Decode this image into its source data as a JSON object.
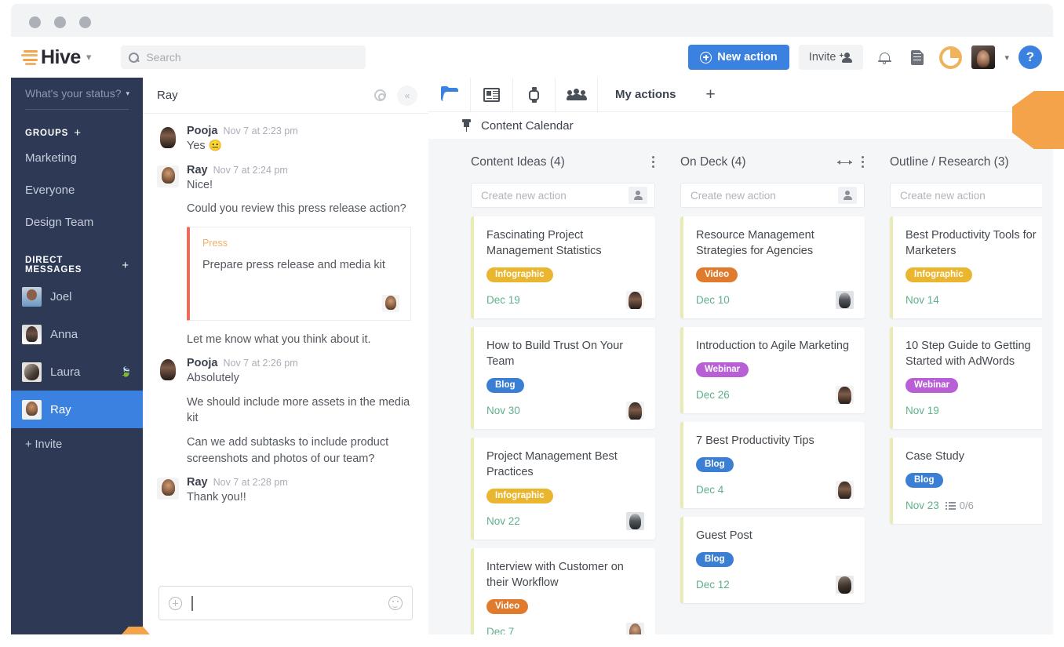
{
  "window": {
    "chrome_dots": [
      "close",
      "minimize",
      "maximize"
    ]
  },
  "header": {
    "logo_text": "Hive",
    "logo_caret": "▾",
    "search": {
      "placeholder": "Search",
      "value": "",
      "icon": "search-icon"
    },
    "new_action_label": "New action",
    "invite_label": "Invite",
    "icons": [
      "bell-icon",
      "document-icon",
      "time-tracking-icon"
    ],
    "avatar_caret": "▾",
    "help_label": "?",
    "accent_blue": "#3b82e0",
    "accent_orange": "#f5a34a"
  },
  "sidebar": {
    "status_placeholder": "What's your status?",
    "status_caret": "▾",
    "groups_label": "GROUPS",
    "groups_add": "+",
    "groups": [
      {
        "label": "Marketing"
      },
      {
        "label": "Everyone"
      },
      {
        "label": "Design Team"
      }
    ],
    "dm_label": "DIRECT MESSAGES",
    "dm_add": "+",
    "dms": [
      {
        "label": "Joel",
        "badge": "",
        "active": false
      },
      {
        "label": "Anna",
        "badge": "",
        "active": false
      },
      {
        "label": "Laura",
        "badge": "🍃",
        "active": false
      },
      {
        "label": "Ray",
        "badge": "",
        "active": true
      }
    ],
    "invite_label": "+ Invite"
  },
  "chat": {
    "title": "Ray",
    "gear_icon": "gear-icon",
    "collapse_icon": "«",
    "messages": [
      {
        "author": "Pooja",
        "time": "Nov 7 at 2:23 pm",
        "text": "Yes",
        "emoji": "😐",
        "avatar": "pooja"
      },
      {
        "author": "Ray",
        "time": "Nov 7 at 2:24 pm",
        "text": "Nice!",
        "avatar": "ray"
      }
    ],
    "ray_followup": "Could you review this press release action?",
    "action_card": {
      "project_tag": "Press",
      "title": "Prepare press release and media kit"
    },
    "ray_followup2": "Let me know what you think about it.",
    "pooja_message": {
      "author": "Pooja",
      "time": "Nov 7 at 2:26 pm",
      "text": "Absolutely",
      "line2": "We should include more assets in the media kit",
      "line3": "Can we add subtasks to include product screenshots and photos of our team?"
    },
    "ray_thanks": {
      "author": "Ray",
      "time": "Nov 7 at 2:28 pm",
      "text": "Thank you!!"
    },
    "input": {
      "placeholder": "",
      "value": "",
      "attach_icon": "plus-circle-icon",
      "emoji_icon": "smiley-icon"
    }
  },
  "project": {
    "toolbar_icons": [
      "folder-icon",
      "news-icon",
      "watch-icon",
      "people-icon"
    ],
    "tabs": [
      {
        "label": "My actions",
        "active": true
      }
    ],
    "add_tab": "+",
    "pin_icon": "pin-icon",
    "name": "Content Calendar"
  },
  "board": {
    "create_placeholder": "Create new action",
    "columns": [
      {
        "title": "Content Ideas (4)",
        "has_resize": false,
        "cards": [
          {
            "title": "Fascinating Project Management Statistics",
            "tag": "Infographic",
            "tag_type": "infographic",
            "date": "Dec 19",
            "subtasks": "",
            "avatar": "av-a"
          },
          {
            "title": "How to Build Trust On Your Team",
            "tag": "Blog",
            "tag_type": "blog",
            "date": "Nov 30",
            "subtasks": "",
            "avatar": "av-a"
          },
          {
            "title": "Project Management Best Practices",
            "tag": "Infographic",
            "tag_type": "infographic",
            "date": "Nov 22",
            "subtasks": "",
            "avatar": "av-b"
          },
          {
            "title": "Interview with Customer on their Workflow",
            "tag": "Video",
            "tag_type": "video",
            "date": "Dec 7",
            "subtasks": "",
            "avatar": "av-c"
          }
        ]
      },
      {
        "title": "On Deck (4)",
        "has_resize": true,
        "cards": [
          {
            "title": "Resource Management Strategies for Agencies",
            "tag": "Video",
            "tag_type": "video",
            "date": "Dec 10",
            "subtasks": "",
            "avatar": "av-b"
          },
          {
            "title": "Introduction to Agile Marketing",
            "tag": "Webinar",
            "tag_type": "webinar",
            "date": "Dec 26",
            "subtasks": "",
            "avatar": "av-a"
          },
          {
            "title": "7 Best Productivity Tips",
            "tag": "Blog",
            "tag_type": "blog",
            "date": "Dec 4",
            "subtasks": "",
            "avatar": "av-a"
          },
          {
            "title": "Guest Post",
            "tag": "Blog",
            "tag_type": "blog",
            "date": "Dec 12",
            "subtasks": "",
            "avatar": "av-d"
          }
        ]
      },
      {
        "title": "Outline / Research (3)",
        "has_resize": true,
        "cards": [
          {
            "title": "Best Productivity Tools for Marketers",
            "tag": "Infographic",
            "tag_type": "infographic",
            "date": "Nov 14",
            "subtasks": "",
            "avatar": "av-c"
          },
          {
            "title": "10 Step Guide to Getting Started with AdWords",
            "tag": "Webinar",
            "tag_type": "webinar",
            "date": "Nov 19",
            "subtasks": "",
            "avatar": "av-b"
          },
          {
            "title": "Case Study",
            "tag": "Blog",
            "tag_type": "blog",
            "date": "Nov 23",
            "subtasks": "0/6",
            "avatar": "av-a"
          }
        ]
      }
    ]
  }
}
